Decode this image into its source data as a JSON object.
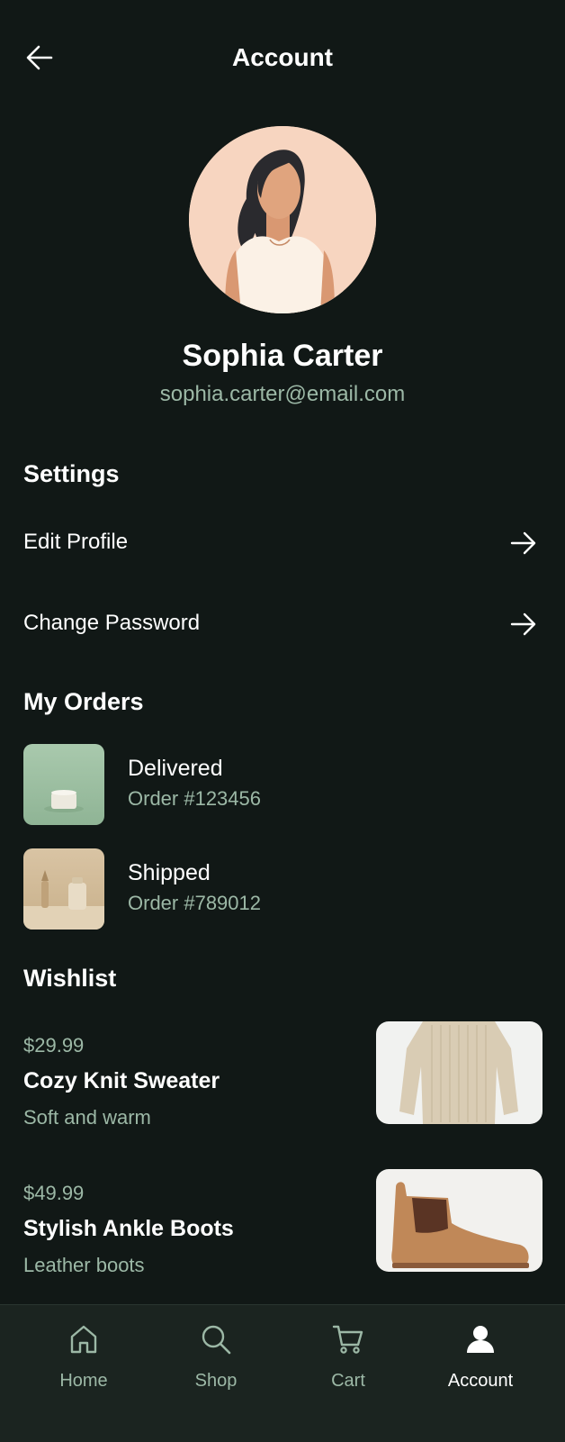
{
  "header": {
    "title": "Account",
    "back_icon": "arrow-left-icon"
  },
  "profile": {
    "name": "Sophia Carter",
    "email": "sophia.carter@email.com"
  },
  "settings": {
    "heading": "Settings",
    "items": [
      {
        "label": "Edit Profile",
        "icon": "arrow-right-icon"
      },
      {
        "label": "Change Password",
        "icon": "arrow-right-icon"
      }
    ]
  },
  "orders": {
    "heading": "My Orders",
    "items": [
      {
        "status": "Delivered",
        "number": "Order #123456"
      },
      {
        "status": "Shipped",
        "number": "Order #789012"
      }
    ]
  },
  "wishlist": {
    "heading": "Wishlist",
    "items": [
      {
        "price": "$29.99",
        "name": "Cozy Knit Sweater",
        "description": "Soft and warm"
      },
      {
        "price": "$49.99",
        "name": "Stylish Ankle Boots",
        "description": "Leather boots"
      }
    ]
  },
  "nav": {
    "items": [
      {
        "label": "Home",
        "icon": "home-icon",
        "active": false
      },
      {
        "label": "Shop",
        "icon": "search-icon",
        "active": false
      },
      {
        "label": "Cart",
        "icon": "cart-icon",
        "active": false
      },
      {
        "label": "Account",
        "icon": "user-icon",
        "active": true
      }
    ]
  },
  "colors": {
    "background": "#111816",
    "nav_background": "#1b2420",
    "muted_text": "#9cb8a6",
    "primary_text": "#ffffff"
  }
}
